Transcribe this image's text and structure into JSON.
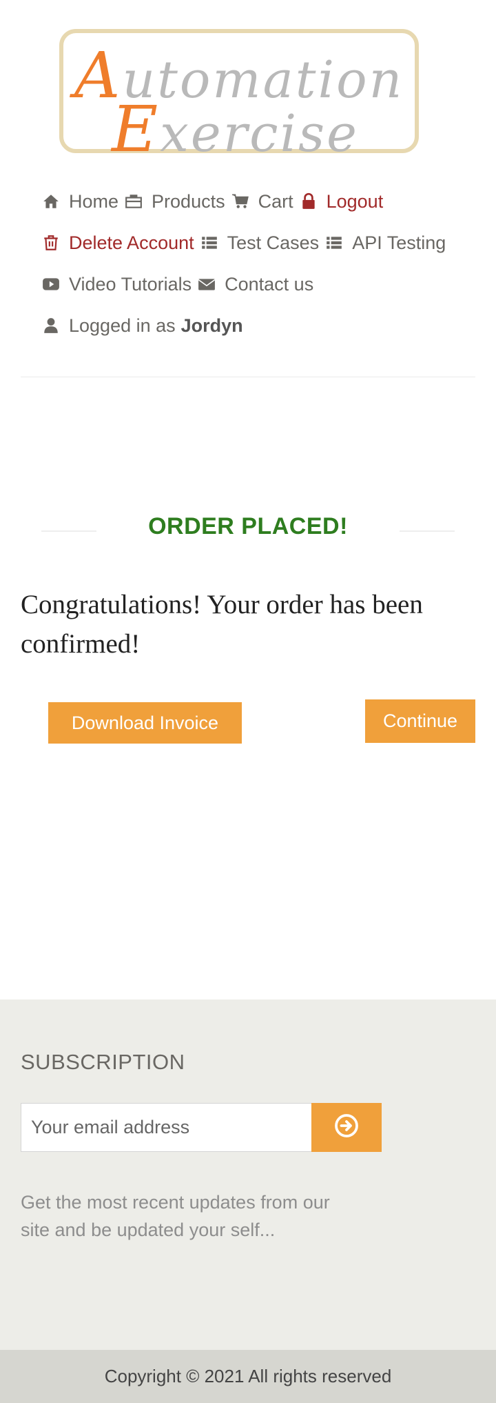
{
  "logo": {
    "line1_cap": "A",
    "line1_rest": "utomation",
    "line2_cap": "E",
    "line2_rest": "xercise"
  },
  "nav": {
    "items": [
      {
        "label": "Home",
        "icon": "home-icon"
      },
      {
        "label": "Products",
        "icon": "briefcase-icon"
      },
      {
        "label": "Cart",
        "icon": "cart-icon"
      },
      {
        "label": "Logout",
        "icon": "lock-icon"
      },
      {
        "label": "Delete Account",
        "icon": "trash-icon"
      },
      {
        "label": "Test Cases",
        "icon": "list-icon"
      },
      {
        "label": "API Testing",
        "icon": "list-icon"
      },
      {
        "label": "Video Tutorials",
        "icon": "youtube-play-icon"
      },
      {
        "label": "Contact us",
        "icon": "envelope-icon"
      }
    ],
    "logged_in_prefix": "Logged in as",
    "username": "Jordyn"
  },
  "order": {
    "title": "ORDER PLACED!",
    "message": "Congratulations! Your order has been confirmed!",
    "download_label": "Download Invoice",
    "continue_label": "Continue"
  },
  "subscription": {
    "title": "SUBSCRIPTION",
    "email_placeholder": "Your email address",
    "submit_icon": "arrow-circle-right-icon",
    "description": "Get the most recent updates from our site and be updated your self..."
  },
  "footer": {
    "copyright": "Copyright © 2021 All rights reserved"
  },
  "colors": {
    "accent": "#f0a03b",
    "success": "#2e7d1f",
    "danger": "#a12a2a",
    "footer_bg": "#edede8"
  }
}
